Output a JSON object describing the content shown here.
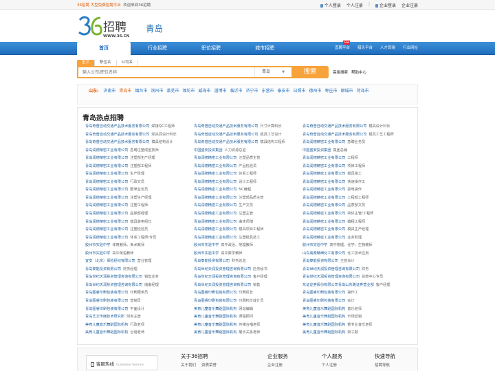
{
  "topbar": {
    "brand": "36招聘",
    "slogan": "大型免费招聘平台",
    "welcome": "欢迎来到36招聘",
    "personal_login": "个人登录",
    "personal_register": "个人注册",
    "company_login": "企业登录",
    "company_register": "企业注册"
  },
  "header": {
    "logo_text": "招聘",
    "logo_url_text": "WWW.36.CN",
    "city": "青岛"
  },
  "nav": {
    "items": [
      "首页",
      "行业招聘",
      "职位招聘",
      "城市招聘"
    ],
    "right": [
      "直聘平台",
      "猎头平台",
      "人才百晓",
      "行业网址"
    ],
    "badge": "new"
  },
  "search": {
    "tabs": [
      "全文",
      "职位名",
      "公司名"
    ],
    "placeholder": "输入公司/职位名称",
    "city": "青岛",
    "button": "搜索",
    "advanced": "高级搜索",
    "help": "帮助中心"
  },
  "cities": {
    "label": "山东:",
    "list": [
      "济南市",
      "青岛市",
      "烟台市",
      "滨州市",
      "莱芜市",
      "潍坊市",
      "威海市",
      "淄博市",
      "临沂市",
      "济宁市",
      "东营市",
      "泰安市",
      "日照市",
      "德州市",
      "枣庄市",
      "聊城市",
      "菏泽市"
    ],
    "current": "青岛市"
  },
  "hot": {
    "title": "青岛热点招聘",
    "jobs": [
      {
        "co": "青岛奇普自动交通产品技术服务有限公司",
        "pos": "焊接QC工程师"
      },
      {
        "co": "青岛奇普自动交通产品技术服务有限公司",
        "pos": "尺寸计算科长"
      },
      {
        "co": "青岛奇普自动交通产品技术服务有限公司",
        "pos": "模具设计科长"
      },
      {
        "co": "青岛奇普自动交通产品技术服务有限公司",
        "pos": "焊夹具设计科长"
      },
      {
        "co": "青岛奇普自动交通产品技术服务有限公司",
        "pos": "模具工艺设计"
      },
      {
        "co": "青岛奇普自动交通产品技术服务有限公司",
        "pos": "模具工艺工程师"
      },
      {
        "co": "青岛奇普自动交通产品技术服务有限公司",
        "pos": "模具结构设计"
      },
      {
        "co": "青岛奇普自动交通产品技术服务有限公司",
        "pos": "模具结构工程师"
      },
      {
        "co": "青岛润德精密工业有限公司",
        "pos": "急聘业务员"
      },
      {
        "co": "青岛润德精密工业有限公司",
        "pos": "急聘注塑成型技师"
      },
      {
        "co": "中国盛安投资集团",
        "pos": "人力资源总监"
      },
      {
        "co": "中国盛安投资集团",
        "pos": "集团总裁"
      },
      {
        "co": "青岛润德精密工业有限公司",
        "pos": "注塑部生产经理"
      },
      {
        "co": "青岛润德精密工业有限公司",
        "pos": "注塑品质主管"
      },
      {
        "co": "青岛润德精密工业有限公司",
        "pos": "工程师"
      },
      {
        "co": "青岛润德精密工业有限公司",
        "pos": "注塑部工程师"
      },
      {
        "co": "青岛润德精密工业有限公司",
        "pos": "产品检验员"
      },
      {
        "co": "青岛润德精密工业有限公司",
        "pos": "项目工程师"
      },
      {
        "co": "青岛润德精密工业有限公司",
        "pos": "生产经理"
      },
      {
        "co": "青岛润德精密工业有限公司",
        "pos": "体系工程师"
      },
      {
        "co": "青岛润德精密工业有限公司",
        "pos": "模具钳工"
      },
      {
        "co": "青岛润德精密工业有限公司",
        "pos": "行政文员"
      },
      {
        "co": "青岛润德精密工业有限公司",
        "pos": "设计工程师"
      },
      {
        "co": "青岛润德精密工业有限公司",
        "pos": "快速操作工"
      },
      {
        "co": "青岛润德精密工业有限公司",
        "pos": "跟单业务员"
      },
      {
        "co": "青岛润德精密工业有限公司",
        "pos": "NC编程"
      },
      {
        "co": "青岛润德精密工业有限公司",
        "pos": "拔电操作"
      },
      {
        "co": "青岛润德精密工业有限公司",
        "pos": "注塑生产经理"
      },
      {
        "co": "青岛润德精密工业有限公司",
        "pos": "注塑部品质主管"
      },
      {
        "co": "青岛润德精密工业有限公司",
        "pos": "工程部工程师"
      },
      {
        "co": "青岛润德精密工业有限公司",
        "pos": "注塑工程师"
      },
      {
        "co": "青岛润德精密工业有限公司",
        "pos": "生产文员"
      },
      {
        "co": "青岛润德精密工业有限公司",
        "pos": "品质部文员"
      },
      {
        "co": "青岛润德精密工业有限公司",
        "pos": "品保部经理"
      },
      {
        "co": "青岛润德精密工业有限公司",
        "pos": "注塑主管"
      },
      {
        "co": "青岛润德精密工业有限公司",
        "pos": "简体主管/工程师"
      },
      {
        "co": "青岛润德精密工业有限公司",
        "pos": "模具装电组长"
      },
      {
        "co": "青岛润德精密工业有限公司",
        "pos": "曲床师傅"
      },
      {
        "co": "青岛润德精密工业有限公司",
        "pos": "编程工程师"
      },
      {
        "co": "青岛润德精密工业有限公司",
        "pos": "注塑检验员"
      },
      {
        "co": "青岛润德精密工业有限公司",
        "pos": "模具项目工程师"
      },
      {
        "co": "青岛润德精密工业有限公司",
        "pos": "模具生产经理"
      },
      {
        "co": "青岛润德精密工业有限公司",
        "pos": "体系工程师/专员"
      },
      {
        "co": "青岛润德精密工业有限公司",
        "pos": "注塑模具技工"
      },
      {
        "co": "青岛润德精密工业有限公司",
        "pos": "业务助理"
      },
      {
        "co": "胶州市实验中学",
        "pos": "体育教师、美术教师"
      },
      {
        "co": "胶州市实验中学",
        "pos": "高中政治、地理教师"
      },
      {
        "co": "胶州市实验中学",
        "pos": "高中物理、化学、生物教师"
      },
      {
        "co": "胶州市实验中学",
        "pos": "高中英语教师"
      },
      {
        "co": "胶州市实验中学",
        "pos": "高中数学教师"
      },
      {
        "co": "山东威泰精细化工有限公司",
        "pos": "化工技术应用"
      },
      {
        "co": "宜安（北京）保险经纪有限公司",
        "pos": "营业管理"
      },
      {
        "co": "青岛泰能投资有限公司",
        "pos": "财务总监"
      },
      {
        "co": "青岛泰能投资有限公司",
        "pos": "主管会计"
      },
      {
        "co": "青岛泰能投资有限公司",
        "pos": "财务经理"
      },
      {
        "co": "青岛世纪天润投资管理咨询有限公司",
        "pos": "店务秘书"
      },
      {
        "co": "青岛世纪天润投资管理咨询有限公司",
        "pos": "财务"
      },
      {
        "co": "青岛世纪天润投资管理咨询有限公司",
        "pos": "销售业务"
      },
      {
        "co": "青岛世纪天润投资管理咨询有限公司",
        "pos": "客户经理"
      },
      {
        "co": "青岛世纪天润投资管理咨询有限公司",
        "pos": "贷款中心专员"
      },
      {
        "co": "青岛世纪天润投资管理咨询有限公司",
        "pos": "储备经理"
      },
      {
        "co": "青岛世纪天润投资管理咨询有限公司",
        "pos": "销售"
      },
      {
        "co": "东证证券股份有限公司青岛山东路证券营业部",
        "pos": "客户经理"
      },
      {
        "co": "青岛图睿印刷包装有限公司",
        "pos": "印刷跟单员"
      },
      {
        "co": "青岛图睿印刷包装有限公司",
        "pos": "印刷机长"
      },
      {
        "co": "青岛图睿印刷包装有限公司",
        "pos": "操作工"
      },
      {
        "co": "青岛图睿印刷包装有限公司",
        "pos": "营销员"
      },
      {
        "co": "青岛图睿印刷包装有限公司",
        "pos": "印刷检价成计员"
      },
      {
        "co": "青岛图睿印刷包装有限公司",
        "pos": "会计"
      },
      {
        "co": "青岛图睿印刷包装有限公司",
        "pos": "平面设计"
      },
      {
        "co": "美育儿童音乐舞蹈国际机构",
        "pos": "网站编辑"
      },
      {
        "co": "美育儿童音乐舞蹈国际机构",
        "pos": "音乐老师"
      },
      {
        "co": "青岛艺文传媒技术研究所",
        "pos": "财务主管"
      },
      {
        "co": "美育儿童音乐舞蹈国际机构",
        "pos": "课程顾问"
      },
      {
        "co": "美育儿童音乐舞蹈国际机构",
        "pos": "市场营销"
      },
      {
        "co": "美育儿童音乐舞蹈国际机构",
        "pos": "行政老师"
      },
      {
        "co": "美育儿童音乐舞蹈国际机构",
        "pos": "传媒合唱老师"
      },
      {
        "co": "美育儿童音乐舞蹈国际机构",
        "pos": "香专业音乐老师"
      },
      {
        "co": "美育儿童音乐舞蹈国际机构",
        "pos": "合唱老师"
      },
      {
        "co": "美育儿童音乐舞蹈国际机构",
        "pos": "展示关系老师"
      },
      {
        "co": "美育儿童音乐舞蹈国际机构",
        "pos": "架子鼓"
      }
    ]
  },
  "footer": {
    "hotline": "客服热线",
    "hotline_sub": "Customer Service",
    "cols": [
      {
        "title": "关于36招聘",
        "links": [
          "关于我们",
          "资质荣誉"
        ]
      },
      {
        "title": "企业服务",
        "links": [
          "企业注册"
        ]
      },
      {
        "title": "个人服务",
        "links": [
          "个人注册"
        ]
      },
      {
        "title": "快速导航",
        "links": [
          "招聘导航"
        ]
      }
    ]
  },
  "colors": {
    "accent": "#f7a23b",
    "nav": "#1f6dbf",
    "link": "#1f5f9f",
    "highlight": "#e05a00"
  }
}
